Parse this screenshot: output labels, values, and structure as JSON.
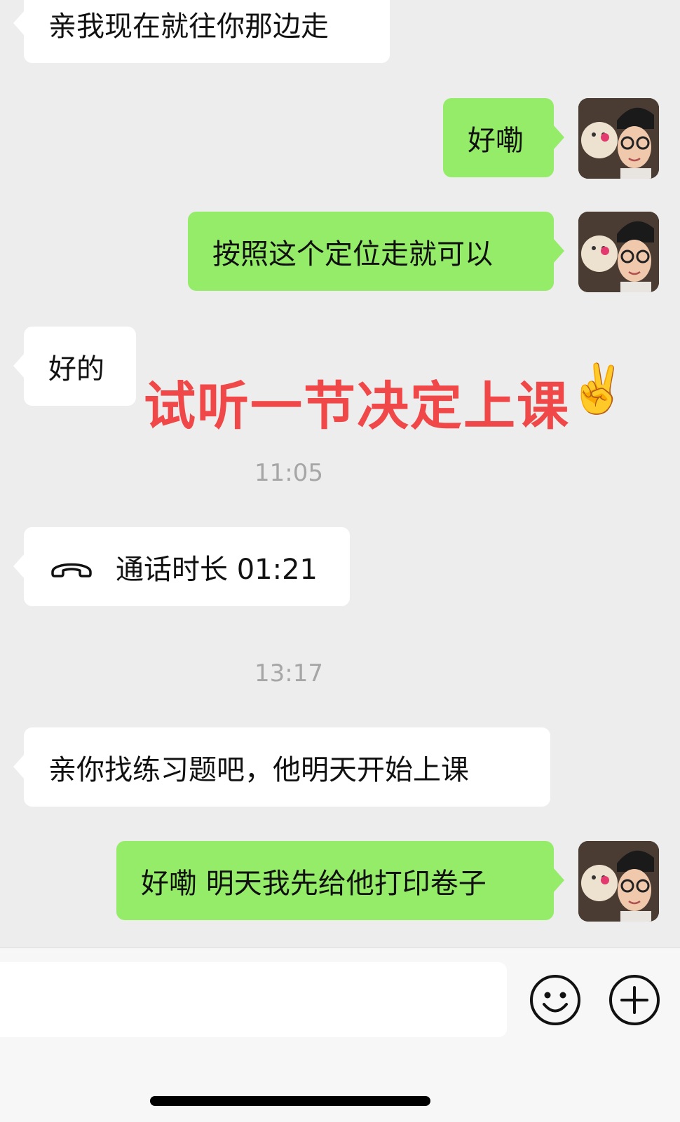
{
  "messages": {
    "m1": "亲我现在就往你那边走",
    "m2": "好嘞",
    "m3": "按照这个定位走就可以",
    "m4": "好的",
    "m5_call_label": "通话时长 01:21",
    "m6": "亲你找练习题吧，他明天开始上课",
    "m7": "好嘞 明天我先给他打印卷子"
  },
  "timestamps": {
    "t1": "11:05",
    "t2": "13:17"
  },
  "overlay": {
    "text": "试听一节决定上课",
    "emoji": "✌️",
    "color": "#f04848"
  },
  "colors": {
    "outgoing_bubble": "#95ec69",
    "incoming_bubble": "#ffffff",
    "background": "#ededed"
  },
  "icons": {
    "call": "phone-hangup-icon",
    "emoji": "smiley-icon",
    "more": "plus-circle-icon"
  }
}
